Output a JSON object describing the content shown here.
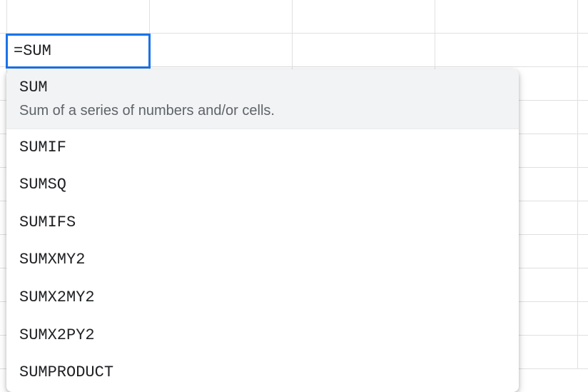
{
  "cell": {
    "value": "=SUM"
  },
  "autocomplete": {
    "highlighted": {
      "name": "SUM",
      "description": "Sum of a series of numbers and/or cells."
    },
    "items": [
      "SUMIF",
      "SUMSQ",
      "SUMIFS",
      "SUMXMY2",
      "SUMX2MY2",
      "SUMX2PY2",
      "SUMPRODUCT"
    ]
  }
}
